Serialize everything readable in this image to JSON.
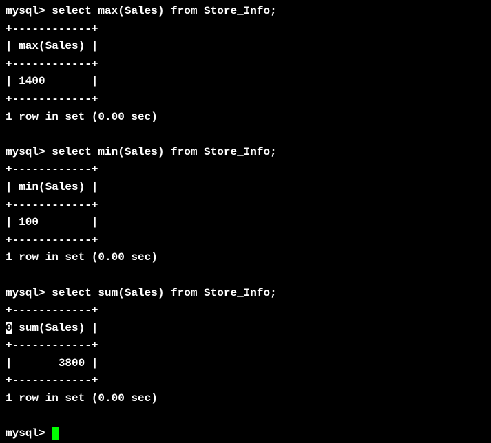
{
  "prompt": "mysql> ",
  "queries": [
    {
      "sql": "select max(Sales) from Store_Info;",
      "header": "max(Sales)",
      "value": "1400      ",
      "footer": "1 row in set (0.00 sec)",
      "border": "+------------+",
      "hl_prefix": ""
    },
    {
      "sql": "select min(Sales) from Store_Info;",
      "header": "min(Sales)",
      "value": "100       ",
      "footer": "1 row in set (0.00 sec)",
      "border": "+------------+",
      "hl_prefix": ""
    },
    {
      "sql": "select sum(Sales) from Store_Info;",
      "header": "sum(Sales)",
      "value": "      3800",
      "footer": "1 row in set (0.00 sec)",
      "border": "+------------+",
      "hl_prefix": "0"
    }
  ]
}
